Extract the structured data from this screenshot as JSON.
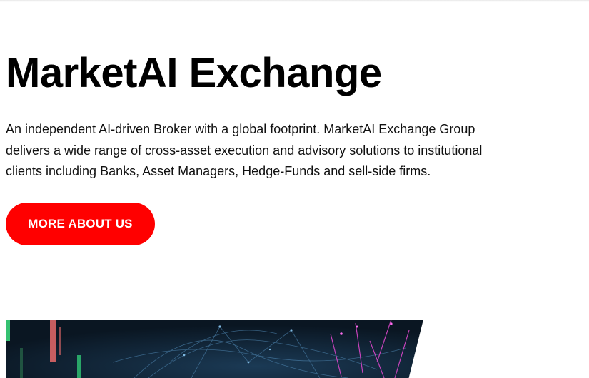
{
  "hero": {
    "title": "MarketAI Exchange",
    "description": "An independent AI-driven Broker with a global footprint. MarketAI Exchange Group delivers a wide range of cross-asset execution and advisory solutions to institutional clients including Banks, Asset Managers, Hedge-Funds and sell-side firms.",
    "cta_label": "MORE ABOUT US"
  },
  "colors": {
    "accent": "#ff0000",
    "image_background": "#0c1a28"
  }
}
